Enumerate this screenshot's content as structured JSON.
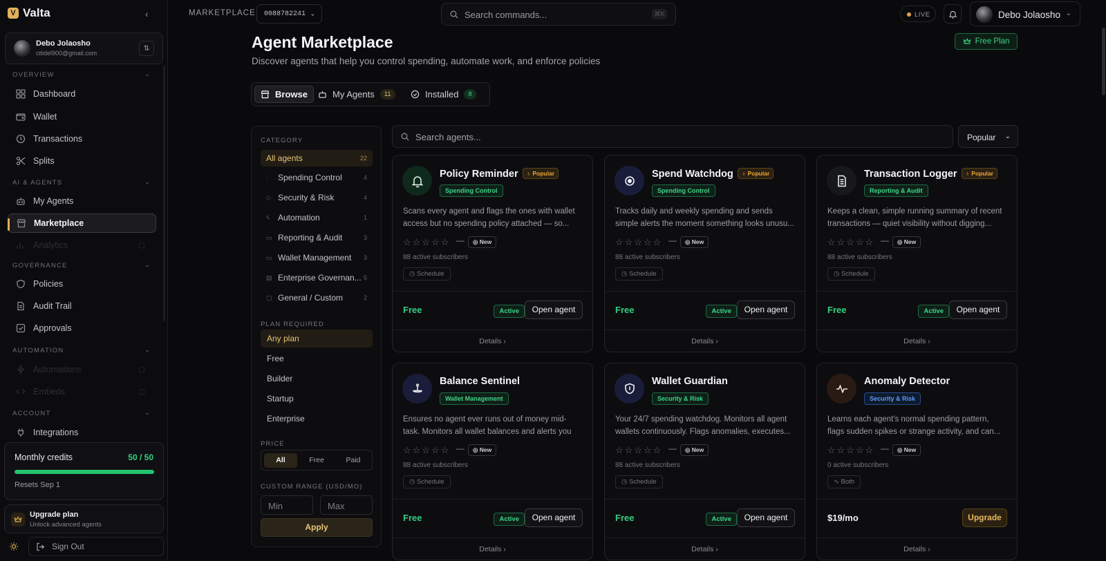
{
  "app": {
    "name": "Valta"
  },
  "sidebar": {
    "user": {
      "name": "Debo Jolaosho",
      "email": "citidel900@gmail.com"
    },
    "sections": {
      "overview": "OVERVIEW",
      "ai": "AI & AGENTS",
      "governance": "GOVERNANCE",
      "automation": "AUTOMATION",
      "account": "ACCOUNT"
    },
    "items": {
      "dashboard": "Dashboard",
      "wallet": "Wallet",
      "transactions": "Transactions",
      "splits": "Splits",
      "my_agents": "My Agents",
      "marketplace": "Marketplace",
      "analytics": "Analytics",
      "policies": "Policies",
      "audit_trail": "Audit Trail",
      "approvals": "Approvals",
      "automations": "Automations",
      "embeds": "Embeds",
      "integrations": "Integrations"
    },
    "credits": {
      "title": "Monthly credits",
      "value": "50 / 50",
      "fraction": 1.0,
      "reset": "Resets Sep 1"
    },
    "upgrade": {
      "title": "Upgrade plan",
      "subtitle": "Unlock advanced agents"
    },
    "sign_out": "Sign Out"
  },
  "topbar": {
    "section": "MARKETPLACE",
    "account_id": "0088782241",
    "search_placeholder": "Search commands...",
    "shortcut": "⌘K",
    "live": "LIVE",
    "user_name": "Debo Jolaosho"
  },
  "page": {
    "title": "Agent Marketplace",
    "subtitle": "Discover agents that help you control spending, automate work, and enforce policies",
    "plan_badge": "Free Plan",
    "tabs": [
      {
        "label": "Browse",
        "count": ""
      },
      {
        "label": "My Agents",
        "count": "11"
      },
      {
        "label": "Installed",
        "count": "8"
      }
    ]
  },
  "filters": {
    "category_label": "CATEGORY",
    "categories": [
      {
        "label": "All agents",
        "count": "22"
      },
      {
        "label": "Spending Control",
        "count": "4"
      },
      {
        "label": "Security & Risk",
        "count": "4"
      },
      {
        "label": "Automation",
        "count": "1"
      },
      {
        "label": "Reporting & Audit",
        "count": "3"
      },
      {
        "label": "Wallet Management",
        "count": "3"
      },
      {
        "label": "Enterprise Governan...",
        "count": "5"
      },
      {
        "label": "General / Custom",
        "count": "2"
      }
    ],
    "plan_label": "PLAN REQUIRED",
    "plans": [
      "Any plan",
      "Free",
      "Builder",
      "Startup",
      "Enterprise"
    ],
    "price_label": "PRICE",
    "price_options": [
      "All",
      "Free",
      "Paid"
    ],
    "range_label": "CUSTOM RANGE (USD/MO)",
    "min_placeholder": "Min",
    "max_placeholder": "Max",
    "apply": "Apply"
  },
  "search": {
    "placeholder": "Search agents...",
    "sort": "Popular"
  },
  "agents": [
    {
      "name": "Policy Reminder",
      "popular": "Popular",
      "category": "Spending Control",
      "desc": "Scans every agent and flags the ones with wallet access but no spending policy attached — so...",
      "new": "New",
      "subs": "88 active subscribers",
      "trigger": "Schedule",
      "price": "Free",
      "status": "Active",
      "action": "Open agent",
      "details": "Details ›"
    },
    {
      "name": "Spend Watchdog",
      "popular": "Popular",
      "category": "Spending Control",
      "desc": "Tracks daily and weekly spending and sends simple alerts the moment something looks unusu...",
      "new": "New",
      "subs": "88 active subscribers",
      "trigger": "Schedule",
      "price": "Free",
      "status": "Active",
      "action": "Open agent",
      "details": "Details ›"
    },
    {
      "name": "Transaction Logger",
      "popular": "Popular",
      "category": "Reporting & Audit",
      "desc": "Keeps a clean, simple running summary of recent transactions — quiet visibility without digging...",
      "new": "New",
      "subs": "88 active subscribers",
      "trigger": "Schedule",
      "price": "Free",
      "status": "Active",
      "action": "Open agent",
      "details": "Details ›"
    },
    {
      "name": "Balance Sentinel",
      "popular": "",
      "category": "Wallet Management",
      "desc": "Ensures no agent ever runs out of money mid-task. Monitors all wallet balances and alerts you befor...",
      "new": "New",
      "subs": "88 active subscribers",
      "trigger": "Schedule",
      "price": "Free",
      "status": "Active",
      "action": "Open agent",
      "details": "Details ›"
    },
    {
      "name": "Wallet Guardian",
      "popular": "",
      "category": "Security & Risk",
      "desc": "Your 24/7 spending watchdog. Monitors all agent wallets continuously. Flags anomalies, executes...",
      "new": "New",
      "subs": "88 active subscribers",
      "trigger": "Schedule",
      "price": "Free",
      "status": "Active",
      "action": "Open agent",
      "details": "Details ›"
    },
    {
      "name": "Anomaly Detector",
      "popular": "",
      "category": "Security & Risk",
      "desc": "Learns each agent's normal spending pattern, flags sudden spikes or strange activity, and can...",
      "new": "New",
      "subs": "0 active subscribers",
      "trigger": "Both",
      "price": "$19/mo",
      "status": "",
      "action": "Upgrade",
      "details": "Details ›"
    }
  ]
}
